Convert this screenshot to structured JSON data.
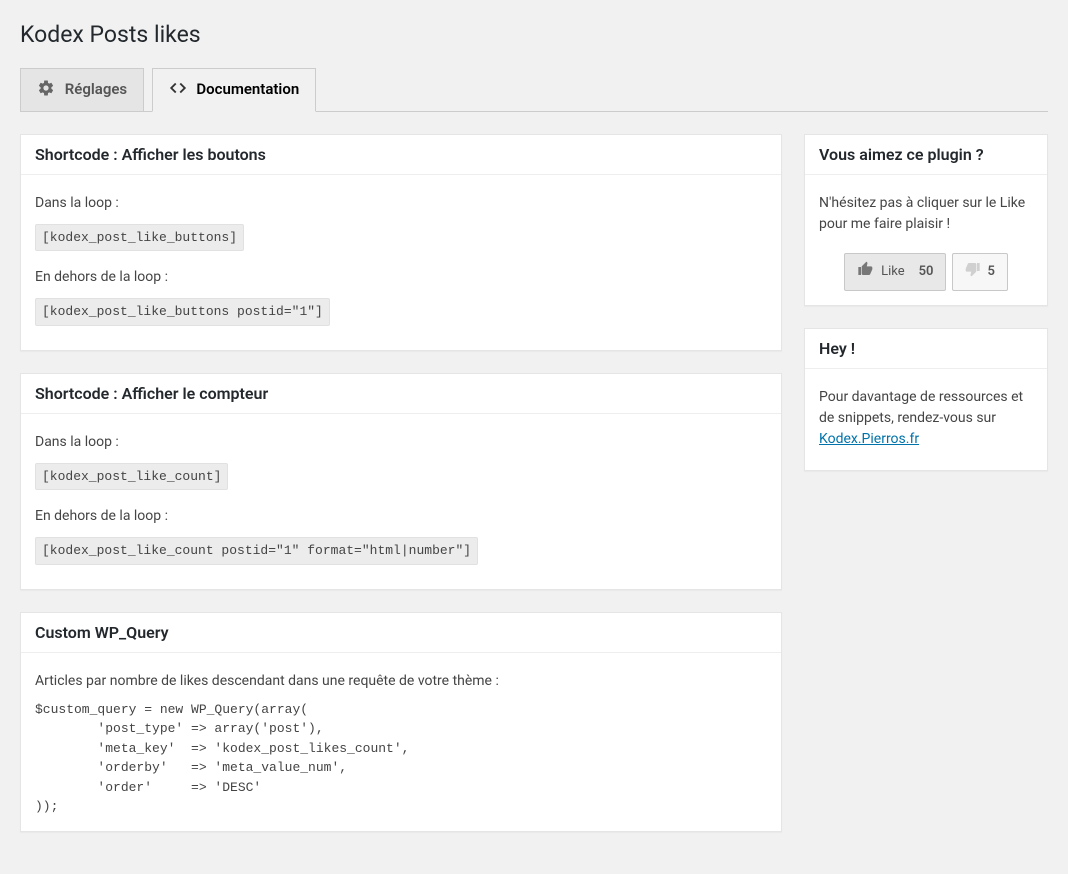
{
  "page": {
    "title": "Kodex Posts likes"
  },
  "tabs": {
    "settings": {
      "label": "Réglages"
    },
    "documentation": {
      "label": "Documentation"
    }
  },
  "sections": {
    "buttons": {
      "heading": "Shortcode : Afficher les boutons",
      "in_loop_label": "Dans la loop :",
      "in_loop_code": "[kodex_post_like_buttons]",
      "out_loop_label": "En dehors de la loop :",
      "out_loop_code": "[kodex_post_like_buttons postid=\"1\"]"
    },
    "counter": {
      "heading": "Shortcode : Afficher le compteur",
      "in_loop_label": "Dans la loop :",
      "in_loop_code": "[kodex_post_like_count]",
      "out_loop_label": "En dehors de la loop :",
      "out_loop_code": "[kodex_post_like_count postid=\"1\" format=\"html|number\"]"
    },
    "wpquery": {
      "heading": "Custom WP_Query",
      "desc": "Articles par nombre de likes descendant dans une requête de votre thème :",
      "code": "$custom_query = new WP_Query(array(\n        'post_type' => array('post'),\n        'meta_key'  => 'kodex_post_likes_count',\n        'orderby'   => 'meta_value_num',\n        'order'     => 'DESC'\n));"
    }
  },
  "sidebar": {
    "like_plugin": {
      "heading": "Vous aimez ce plugin ?",
      "text": "N'hésitez pas à cliquer sur le Like pour me faire plaisir !",
      "like_label": "Like",
      "like_count": "50",
      "dislike_count": "5"
    },
    "hey": {
      "heading": "Hey !",
      "text": "Pour davantage de ressources et de snippets, rendez-vous sur ",
      "link_label": "Kodex.Pierros.fr"
    }
  }
}
